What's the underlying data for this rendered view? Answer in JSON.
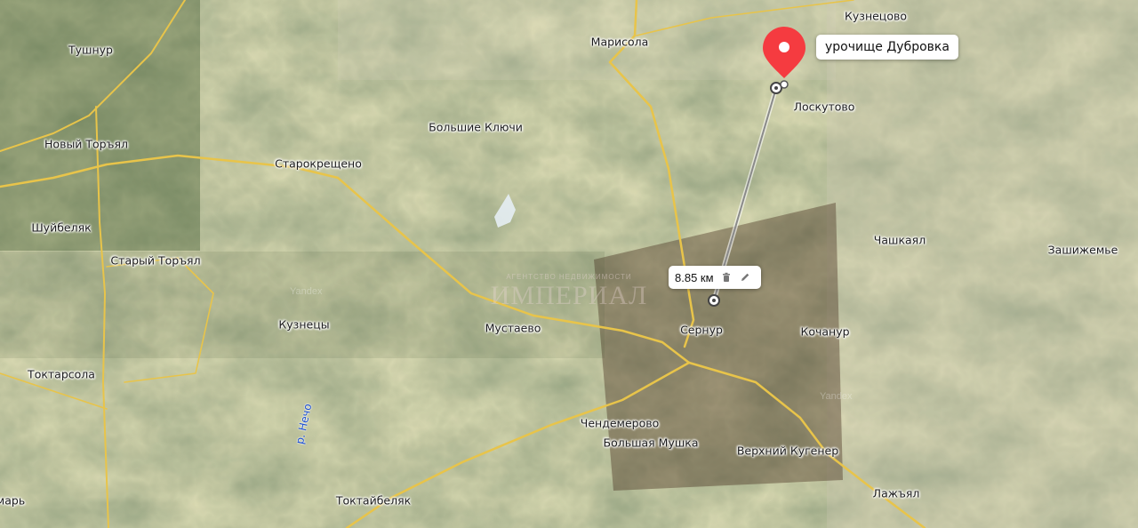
{
  "places": [
    {
      "name": "Тушнур"
    },
    {
      "name": "Марисола"
    },
    {
      "name": "Кузнецово"
    },
    {
      "name": "Лоскутово"
    },
    {
      "name": "Большие Ключи"
    },
    {
      "name": "Новый Торъял"
    },
    {
      "name": "Старокрещено"
    },
    {
      "name": "Шуйбеляк"
    },
    {
      "name": "Чашкаял"
    },
    {
      "name": "Зашижемье"
    },
    {
      "name": "Старый Торъял"
    },
    {
      "name": "Кузнецы"
    },
    {
      "name": "Мустаево"
    },
    {
      "name": "Сернур"
    },
    {
      "name": "Кочанур"
    },
    {
      "name": "Токтарсола"
    },
    {
      "name": "Чендемерово"
    },
    {
      "name": "Большая Мушка"
    },
    {
      "name": "Верхний Кугенер"
    },
    {
      "name": "Лажъял"
    },
    {
      "name": "Токтайбеляк"
    },
    {
      "name": "марь"
    }
  ],
  "river_label": "р. Нечо",
  "pin": {
    "label": "урочище Дубровка",
    "color": "#f53b40"
  },
  "measure": {
    "distance": "8.85 км"
  },
  "watermark": {
    "title": "ИМПЕРИАЛ",
    "subtitle": "АГЕНТСТВО НЕДВИЖИМОСТИ"
  },
  "map_credit": "Yandex",
  "icons": {
    "delete": "trash-icon",
    "edit": "pencil-icon"
  }
}
